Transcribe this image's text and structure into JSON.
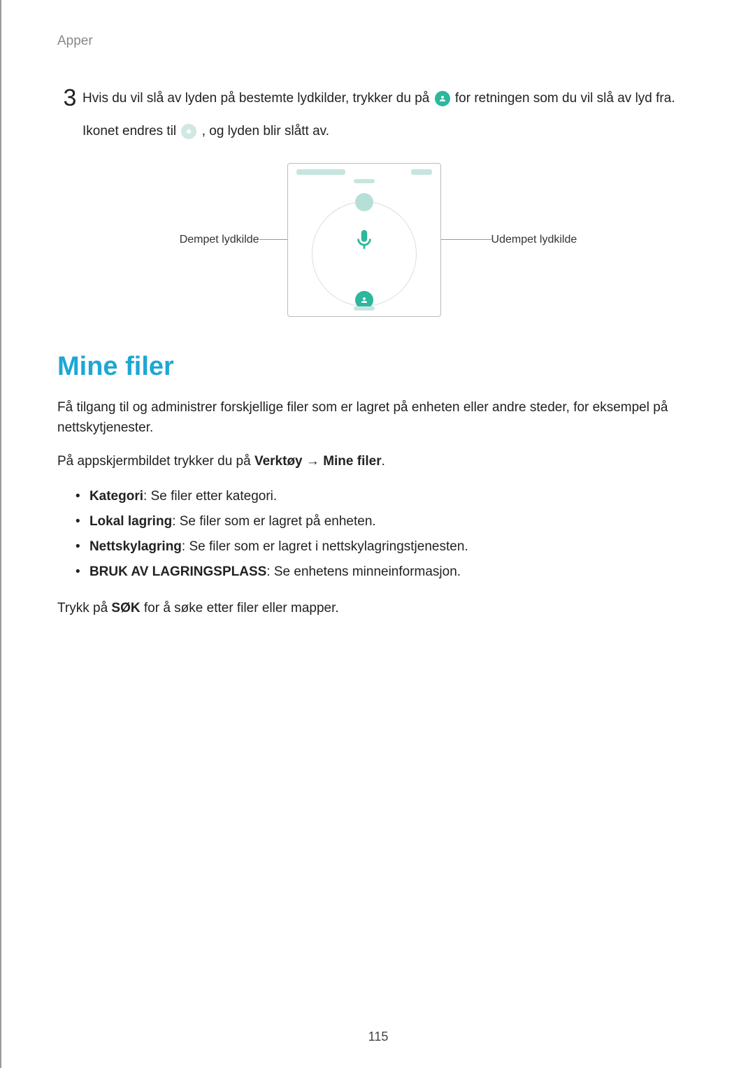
{
  "header": {
    "section": "Apper"
  },
  "step": {
    "number": "3",
    "line1_pre": "Hvis du vil slå av lyden på bestemte lydkilder, trykker du på ",
    "line1_post": " for retningen som du vil slå av lyd fra.",
    "line2_pre": "Ikonet endres til ",
    "line2_post": ", og lyden blir slått av."
  },
  "figure": {
    "left_label": "Dempet lydkilde",
    "right_label": "Udempet lydkilde"
  },
  "mine_filer": {
    "title": "Mine filer",
    "intro": "Få tilgang til og administrer forskjellige filer som er lagret på enheten eller andre steder, for eksempel på nettskytjenester.",
    "path_pre": "På appskjermbildet trykker du på ",
    "path_tool": "Verktøy",
    "path_arrow": " → ",
    "path_target": "Mine filer",
    "path_post": ".",
    "bullets": [
      {
        "term": "Kategori",
        "desc": ": Se filer etter kategori."
      },
      {
        "term": "Lokal lagring",
        "desc": ": Se filer som er lagret på enheten."
      },
      {
        "term": "Nettskylagring",
        "desc": ": Se filer som er lagret i nettskylagringstjenesten."
      },
      {
        "term": "BRUK AV LAGRINGSPLASS",
        "desc": ": Se enhetens minneinformasjon."
      }
    ],
    "search_pre": "Trykk på ",
    "search_bold": "SØK",
    "search_post": " for å søke etter filer eller mapper."
  },
  "page_number": "115"
}
